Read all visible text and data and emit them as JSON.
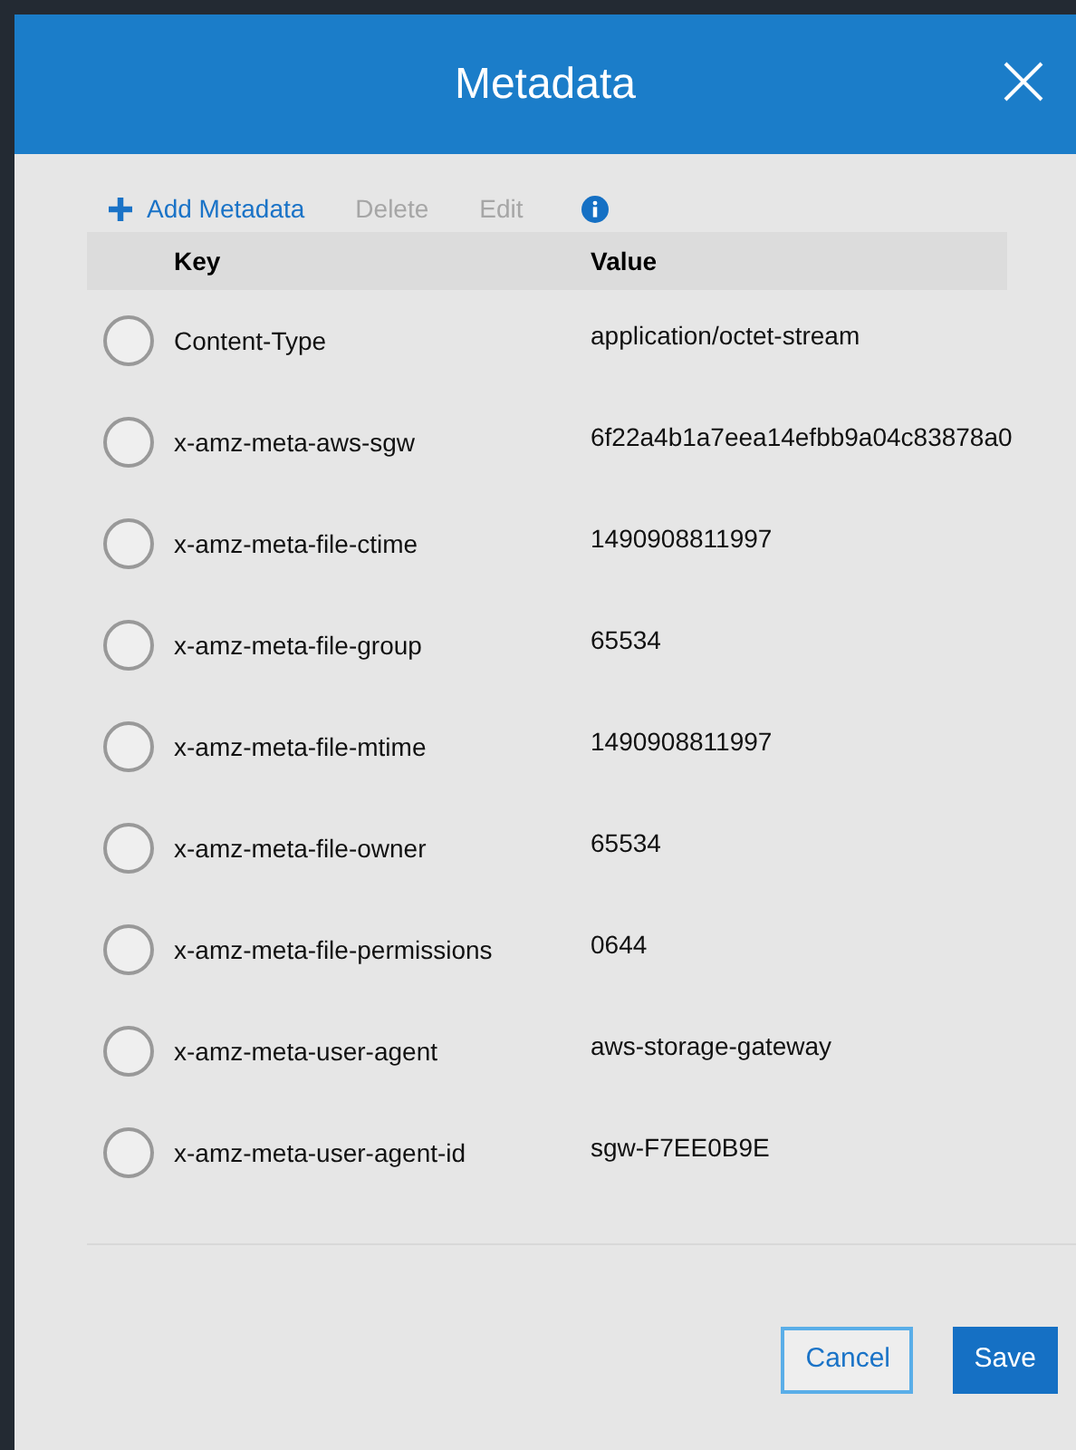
{
  "dialog": {
    "title": "Metadata"
  },
  "toolbar": [
    {
      "label": "Add Metadata",
      "kind": "add",
      "disabled": false
    },
    {
      "label": "Delete",
      "kind": "text",
      "disabled": true
    },
    {
      "label": "Edit",
      "kind": "text",
      "disabled": true
    },
    {
      "kind": "info",
      "disabled": false
    }
  ],
  "table": {
    "columns": [
      "Key",
      "Value"
    ],
    "rows": [
      {
        "key": "Content-Type",
        "value": "application/octet-stream",
        "selected": false
      },
      {
        "key": "x-amz-meta-aws-sgw",
        "value": "6f22a4b1a7eea14efbb9a04c83878a0",
        "selected": false
      },
      {
        "key": "x-amz-meta-file-ctime",
        "value": "1490908811997",
        "selected": false
      },
      {
        "key": "x-amz-meta-file-group",
        "value": "65534",
        "selected": false
      },
      {
        "key": "x-amz-meta-file-mtime",
        "value": "1490908811997",
        "selected": false
      },
      {
        "key": "x-amz-meta-file-owner",
        "value": "65534",
        "selected": false
      },
      {
        "key": "x-amz-meta-file-permissions",
        "value": "0644",
        "selected": false
      },
      {
        "key": "x-amz-meta-user-agent",
        "value": "aws-storage-gateway",
        "selected": false
      },
      {
        "key": "x-amz-meta-user-agent-id",
        "value": "sgw-F7EE0B9E",
        "selected": false
      }
    ]
  },
  "buttons": [
    {
      "label": "Cancel",
      "kind": "secondary"
    },
    {
      "label": "Save",
      "kind": "primary"
    }
  ]
}
